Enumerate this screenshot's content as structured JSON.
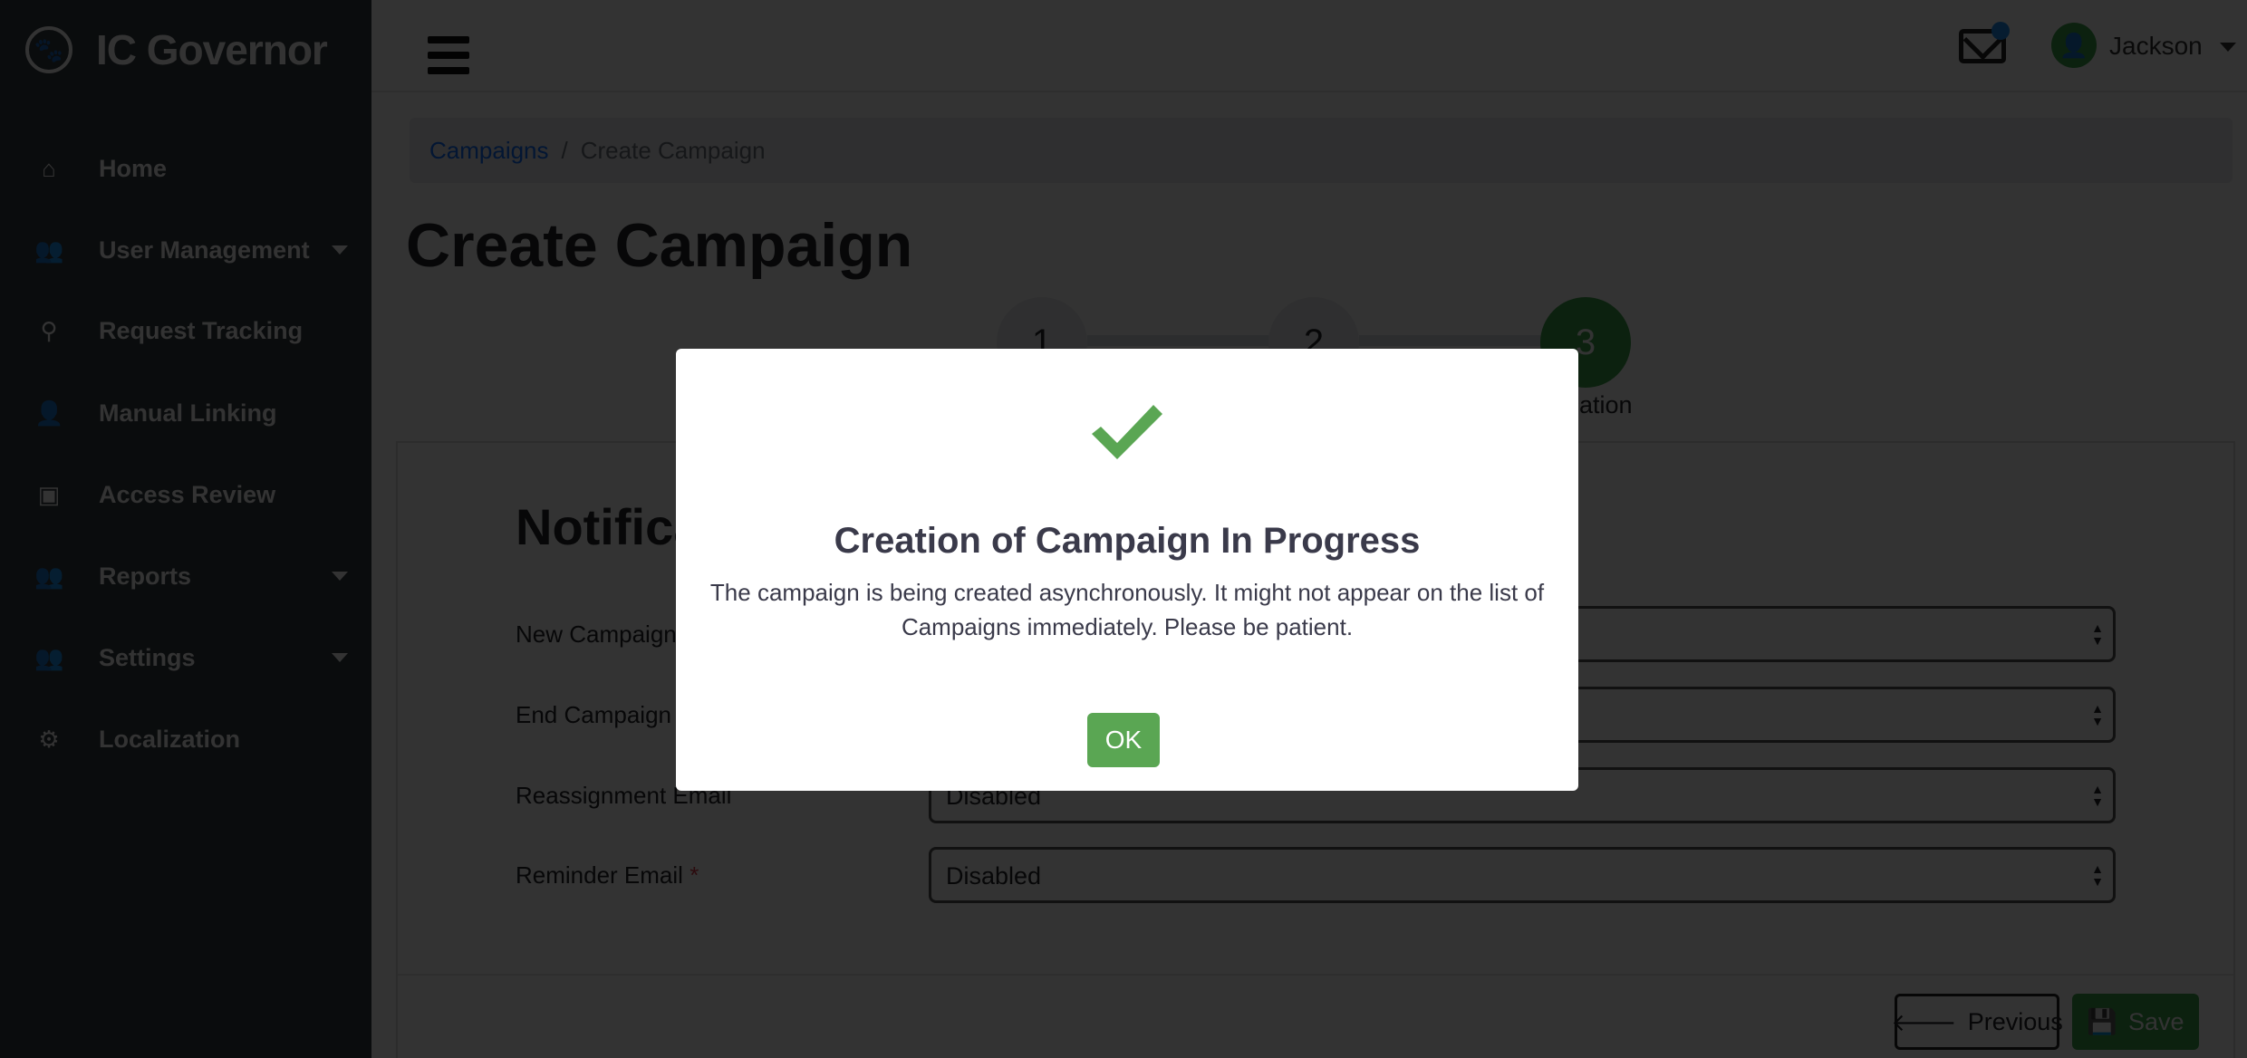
{
  "app": {
    "title": "IC Governor",
    "logo_icon": "paw-icon"
  },
  "sidebar": {
    "items": [
      {
        "label": "Home",
        "icon": "home-icon",
        "glyph": "⌂",
        "caret": false
      },
      {
        "label": "User Management",
        "icon": "users-icon",
        "glyph": "👥",
        "caret": true
      },
      {
        "label": "Request Tracking",
        "icon": "search-icon",
        "glyph": "⚲",
        "caret": false
      },
      {
        "label": "Manual Linking",
        "icon": "user-icon",
        "glyph": "👤",
        "caret": false
      },
      {
        "label": "Access Review",
        "icon": "badge-icon",
        "glyph": "▣",
        "caret": false
      },
      {
        "label": "Reports",
        "icon": "users-icon",
        "glyph": "👥",
        "caret": true
      },
      {
        "label": "Settings",
        "icon": "users-icon",
        "glyph": "👥",
        "caret": true
      },
      {
        "label": "Localization",
        "icon": "gear-icon",
        "glyph": "⚙",
        "caret": false
      }
    ]
  },
  "header": {
    "user_name": "Jackson",
    "notification_color": "#1f8ef1"
  },
  "breadcrumb": {
    "items": [
      "Campaigns",
      "Create Campaign"
    ],
    "separator": "/"
  },
  "page": {
    "title": "Create Campaign"
  },
  "steps": [
    {
      "number": "1"
    },
    {
      "number": "2"
    },
    {
      "number": "3",
      "label": "Notification",
      "active": true
    }
  ],
  "form": {
    "section_title": "Notification",
    "fields": [
      {
        "label": "New Campaign Email",
        "value": ""
      },
      {
        "label": "End Campaign Email",
        "value": ""
      },
      {
        "label": "Reassignment Email",
        "value": "Disabled"
      },
      {
        "label": "Reminder Email",
        "required": "*",
        "value": "Disabled"
      }
    ],
    "previous_label": "Previous",
    "save_label": "Save"
  },
  "modal": {
    "icon": "checkmark-icon",
    "title": "Creation of Campaign In Progress",
    "body": "The campaign is being created asynchronously. It might not appear on the list of Campaigns immediately. Please be patient.",
    "ok_label": "OK",
    "accent": "#5aa653"
  }
}
